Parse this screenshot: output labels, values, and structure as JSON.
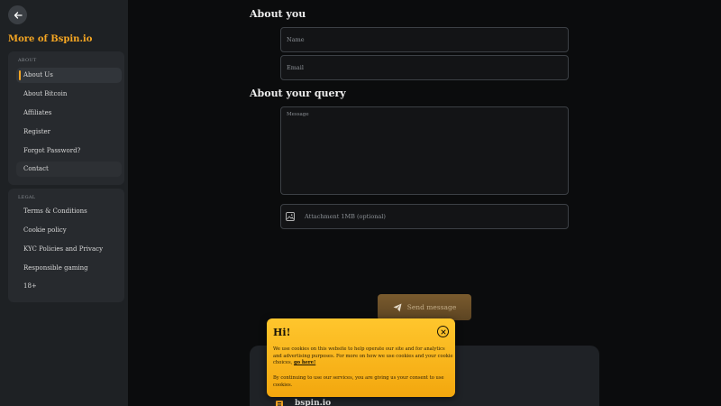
{
  "sidebar": {
    "title": "More of Bspin.io",
    "about_label": "ABOUT",
    "about_items": [
      "About Us",
      "About Bitcoin",
      "Affiliates",
      "Register",
      "Forgot Password?",
      "Contact"
    ],
    "legal_label": "LEGAL",
    "legal_items": [
      "Terms & Conditions",
      "Cookie policy",
      "KYC Policies and Privacy",
      "Responsible gaming",
      "18+"
    ]
  },
  "form": {
    "about_you_heading": "About you",
    "name_placeholder": "Name",
    "email_placeholder": "Email",
    "query_heading": "About your query",
    "message_placeholder": "Message",
    "attachment_label": "Attachment 1MB (optional)",
    "send_label": "Send message"
  },
  "footer": {
    "brand": "bspin.io"
  },
  "cookie": {
    "title": "Hi!",
    "text1": "We use cookies on this website to help operate our site and for analytics and advertising purposes. For more on how we use cookies and your cookie choices, ",
    "link": "go here!",
    "text2": "By continuing to use our services, you are giving us your consent to use cookies."
  },
  "colors": {
    "accent": "#f5a623",
    "cookie_bg": "#ffc62d",
    "sidebar_bg": "#1e2124"
  },
  "icons": {
    "back": "arrow-left-icon",
    "attach": "image-icon",
    "send": "paper-plane-icon",
    "close": "close-icon"
  }
}
